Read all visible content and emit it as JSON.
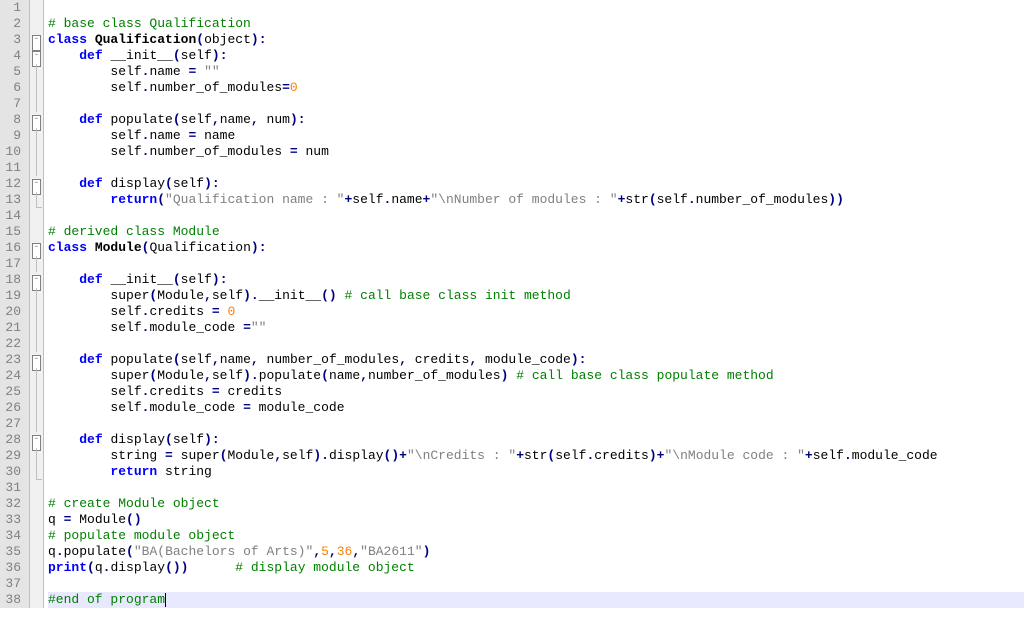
{
  "lines": [
    {
      "n": 1,
      "fold": "",
      "tokens": []
    },
    {
      "n": 2,
      "fold": "",
      "tokens": [
        [
          "cm",
          "# base class Qualification"
        ]
      ]
    },
    {
      "n": 3,
      "fold": "box",
      "tokens": [
        [
          "kw",
          "class"
        ],
        [
          "id",
          " "
        ],
        [
          "cls",
          "Qualification"
        ],
        [
          "op",
          "("
        ],
        [
          "id",
          "object"
        ],
        [
          "op",
          ")"
        ],
        [
          "op",
          ":"
        ]
      ]
    },
    {
      "n": 4,
      "fold": "box",
      "tokens": [
        [
          "id",
          "    "
        ],
        [
          "kw",
          "def"
        ],
        [
          "id",
          " "
        ],
        [
          "fn",
          "__init__"
        ],
        [
          "op",
          "("
        ],
        [
          "self",
          "self"
        ],
        [
          "op",
          ")"
        ],
        [
          "op",
          ":"
        ]
      ]
    },
    {
      "n": 5,
      "fold": "line",
      "tokens": [
        [
          "id",
          "        self"
        ],
        [
          "op",
          "."
        ],
        [
          "id",
          "name "
        ],
        [
          "op",
          "="
        ],
        [
          "id",
          " "
        ],
        [
          "str",
          "\"\""
        ]
      ]
    },
    {
      "n": 6,
      "fold": "line",
      "tokens": [
        [
          "id",
          "        self"
        ],
        [
          "op",
          "."
        ],
        [
          "id",
          "number_of_modules"
        ],
        [
          "op",
          "="
        ],
        [
          "num",
          "0"
        ]
      ]
    },
    {
      "n": 7,
      "fold": "line",
      "tokens": []
    },
    {
      "n": 8,
      "fold": "box",
      "tokens": [
        [
          "id",
          "    "
        ],
        [
          "kw",
          "def"
        ],
        [
          "id",
          " "
        ],
        [
          "fn",
          "populate"
        ],
        [
          "op",
          "("
        ],
        [
          "self",
          "self"
        ],
        [
          "op",
          ","
        ],
        [
          "id",
          "name"
        ],
        [
          "op",
          ","
        ],
        [
          "id",
          " num"
        ],
        [
          "op",
          ")"
        ],
        [
          "op",
          ":"
        ]
      ]
    },
    {
      "n": 9,
      "fold": "line",
      "tokens": [
        [
          "id",
          "        self"
        ],
        [
          "op",
          "."
        ],
        [
          "id",
          "name "
        ],
        [
          "op",
          "="
        ],
        [
          "id",
          " name"
        ]
      ]
    },
    {
      "n": 10,
      "fold": "line",
      "tokens": [
        [
          "id",
          "        self"
        ],
        [
          "op",
          "."
        ],
        [
          "id",
          "number_of_modules "
        ],
        [
          "op",
          "="
        ],
        [
          "id",
          " num"
        ]
      ]
    },
    {
      "n": 11,
      "fold": "line",
      "tokens": []
    },
    {
      "n": 12,
      "fold": "box",
      "tokens": [
        [
          "id",
          "    "
        ],
        [
          "kw",
          "def"
        ],
        [
          "id",
          " "
        ],
        [
          "fn",
          "display"
        ],
        [
          "op",
          "("
        ],
        [
          "self",
          "self"
        ],
        [
          "op",
          ")"
        ],
        [
          "op",
          ":"
        ]
      ]
    },
    {
      "n": 13,
      "fold": "end",
      "tokens": [
        [
          "id",
          "        "
        ],
        [
          "kw",
          "return"
        ],
        [
          "op",
          "("
        ],
        [
          "str",
          "\"Qualification name : \""
        ],
        [
          "op",
          "+"
        ],
        [
          "id",
          "self"
        ],
        [
          "op",
          "."
        ],
        [
          "id",
          "name"
        ],
        [
          "op",
          "+"
        ],
        [
          "str",
          "\"\\nNumber of modules : \""
        ],
        [
          "op",
          "+"
        ],
        [
          "id",
          "str"
        ],
        [
          "op",
          "("
        ],
        [
          "id",
          "self"
        ],
        [
          "op",
          "."
        ],
        [
          "id",
          "number_of_modules"
        ],
        [
          "op",
          "))"
        ]
      ]
    },
    {
      "n": 14,
      "fold": "",
      "tokens": []
    },
    {
      "n": 15,
      "fold": "",
      "tokens": [
        [
          "cm",
          "# derived class Module"
        ]
      ]
    },
    {
      "n": 16,
      "fold": "box",
      "tokens": [
        [
          "kw",
          "class"
        ],
        [
          "id",
          " "
        ],
        [
          "cls",
          "Module"
        ],
        [
          "op",
          "("
        ],
        [
          "id",
          "Qualification"
        ],
        [
          "op",
          ")"
        ],
        [
          "op",
          ":"
        ]
      ]
    },
    {
      "n": 17,
      "fold": "line",
      "tokens": []
    },
    {
      "n": 18,
      "fold": "box",
      "tokens": [
        [
          "id",
          "    "
        ],
        [
          "kw",
          "def"
        ],
        [
          "id",
          " "
        ],
        [
          "fn",
          "__init__"
        ],
        [
          "op",
          "("
        ],
        [
          "self",
          "self"
        ],
        [
          "op",
          ")"
        ],
        [
          "op",
          ":"
        ]
      ]
    },
    {
      "n": 19,
      "fold": "line",
      "tokens": [
        [
          "id",
          "        super"
        ],
        [
          "op",
          "("
        ],
        [
          "id",
          "Module"
        ],
        [
          "op",
          ","
        ],
        [
          "id",
          "self"
        ],
        [
          "op",
          ")"
        ],
        [
          "op",
          "."
        ],
        [
          "id",
          "__init__"
        ],
        [
          "op",
          "()"
        ],
        [
          "id",
          " "
        ],
        [
          "cm",
          "# call base class init method"
        ]
      ]
    },
    {
      "n": 20,
      "fold": "line",
      "tokens": [
        [
          "id",
          "        self"
        ],
        [
          "op",
          "."
        ],
        [
          "id",
          "credits "
        ],
        [
          "op",
          "="
        ],
        [
          "id",
          " "
        ],
        [
          "num",
          "0"
        ]
      ]
    },
    {
      "n": 21,
      "fold": "line",
      "tokens": [
        [
          "id",
          "        self"
        ],
        [
          "op",
          "."
        ],
        [
          "id",
          "module_code "
        ],
        [
          "op",
          "="
        ],
        [
          "str",
          "\"\""
        ]
      ]
    },
    {
      "n": 22,
      "fold": "line",
      "tokens": []
    },
    {
      "n": 23,
      "fold": "box",
      "tokens": [
        [
          "id",
          "    "
        ],
        [
          "kw",
          "def"
        ],
        [
          "id",
          " "
        ],
        [
          "fn",
          "populate"
        ],
        [
          "op",
          "("
        ],
        [
          "self",
          "self"
        ],
        [
          "op",
          ","
        ],
        [
          "id",
          "name"
        ],
        [
          "op",
          ","
        ],
        [
          "id",
          " number_of_modules"
        ],
        [
          "op",
          ","
        ],
        [
          "id",
          " credits"
        ],
        [
          "op",
          ","
        ],
        [
          "id",
          " module_code"
        ],
        [
          "op",
          ")"
        ],
        [
          "op",
          ":"
        ]
      ]
    },
    {
      "n": 24,
      "fold": "line",
      "tokens": [
        [
          "id",
          "        super"
        ],
        [
          "op",
          "("
        ],
        [
          "id",
          "Module"
        ],
        [
          "op",
          ","
        ],
        [
          "id",
          "self"
        ],
        [
          "op",
          ")"
        ],
        [
          "op",
          "."
        ],
        [
          "id",
          "populate"
        ],
        [
          "op",
          "("
        ],
        [
          "id",
          "name"
        ],
        [
          "op",
          ","
        ],
        [
          "id",
          "number_of_modules"
        ],
        [
          "op",
          ")"
        ],
        [
          "id",
          " "
        ],
        [
          "cm",
          "# call base class populate method"
        ]
      ]
    },
    {
      "n": 25,
      "fold": "line",
      "tokens": [
        [
          "id",
          "        self"
        ],
        [
          "op",
          "."
        ],
        [
          "id",
          "credits "
        ],
        [
          "op",
          "="
        ],
        [
          "id",
          " credits"
        ]
      ]
    },
    {
      "n": 26,
      "fold": "line",
      "tokens": [
        [
          "id",
          "        self"
        ],
        [
          "op",
          "."
        ],
        [
          "id",
          "module_code "
        ],
        [
          "op",
          "="
        ],
        [
          "id",
          " module_code"
        ]
      ]
    },
    {
      "n": 27,
      "fold": "line",
      "tokens": []
    },
    {
      "n": 28,
      "fold": "box",
      "tokens": [
        [
          "id",
          "    "
        ],
        [
          "kw",
          "def"
        ],
        [
          "id",
          " "
        ],
        [
          "fn",
          "display"
        ],
        [
          "op",
          "("
        ],
        [
          "self",
          "self"
        ],
        [
          "op",
          ")"
        ],
        [
          "op",
          ":"
        ]
      ]
    },
    {
      "n": 29,
      "fold": "line",
      "tokens": [
        [
          "id",
          "        string "
        ],
        [
          "op",
          "="
        ],
        [
          "id",
          " super"
        ],
        [
          "op",
          "("
        ],
        [
          "id",
          "Module"
        ],
        [
          "op",
          ","
        ],
        [
          "id",
          "self"
        ],
        [
          "op",
          ")"
        ],
        [
          "op",
          "."
        ],
        [
          "id",
          "display"
        ],
        [
          "op",
          "()"
        ],
        [
          "op",
          "+"
        ],
        [
          "str",
          "\"\\nCredits : \""
        ],
        [
          "op",
          "+"
        ],
        [
          "id",
          "str"
        ],
        [
          "op",
          "("
        ],
        [
          "id",
          "self"
        ],
        [
          "op",
          "."
        ],
        [
          "id",
          "credits"
        ],
        [
          "op",
          ")"
        ],
        [
          "op",
          "+"
        ],
        [
          "str",
          "\"\\nModule code : \""
        ],
        [
          "op",
          "+"
        ],
        [
          "id",
          "self"
        ],
        [
          "op",
          "."
        ],
        [
          "id",
          "module_code"
        ]
      ]
    },
    {
      "n": 30,
      "fold": "end",
      "tokens": [
        [
          "id",
          "        "
        ],
        [
          "kw",
          "return"
        ],
        [
          "id",
          " string"
        ]
      ]
    },
    {
      "n": 31,
      "fold": "",
      "tokens": []
    },
    {
      "n": 32,
      "fold": "",
      "tokens": [
        [
          "cm",
          "# create Module object"
        ]
      ]
    },
    {
      "n": 33,
      "fold": "",
      "tokens": [
        [
          "id",
          "q "
        ],
        [
          "op",
          "="
        ],
        [
          "id",
          " Module"
        ],
        [
          "op",
          "()"
        ]
      ]
    },
    {
      "n": 34,
      "fold": "",
      "tokens": [
        [
          "cm",
          "# populate module object"
        ]
      ]
    },
    {
      "n": 35,
      "fold": "",
      "tokens": [
        [
          "id",
          "q"
        ],
        [
          "op",
          "."
        ],
        [
          "id",
          "populate"
        ],
        [
          "op",
          "("
        ],
        [
          "str",
          "\"BA(Bachelors of Arts)\""
        ],
        [
          "op",
          ","
        ],
        [
          "num",
          "5"
        ],
        [
          "op",
          ","
        ],
        [
          "num",
          "36"
        ],
        [
          "op",
          ","
        ],
        [
          "str",
          "\"BA2611\""
        ],
        [
          "op",
          ")"
        ]
      ]
    },
    {
      "n": 36,
      "fold": "",
      "tokens": [
        [
          "kw",
          "print"
        ],
        [
          "op",
          "("
        ],
        [
          "id",
          "q"
        ],
        [
          "op",
          "."
        ],
        [
          "id",
          "display"
        ],
        [
          "op",
          "())"
        ],
        [
          "id",
          "      "
        ],
        [
          "cm",
          "# display module object"
        ]
      ]
    },
    {
      "n": 37,
      "fold": "",
      "tokens": []
    },
    {
      "n": 38,
      "fold": "",
      "current": true,
      "tokens": [
        [
          "cm",
          "#end of program"
        ]
      ],
      "cursor": true
    }
  ]
}
